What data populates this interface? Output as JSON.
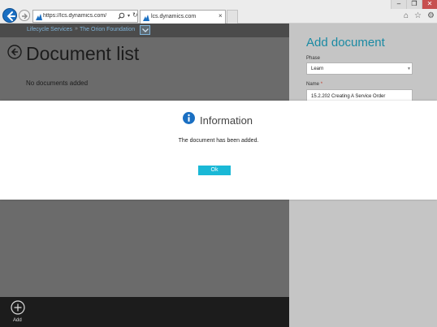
{
  "browser": {
    "address_text": "https://lcs.dynamics.com/Docum",
    "tab_title": "lcs.dynamics.com"
  },
  "breadcrumb": {
    "root": "Lifecycle Services",
    "separator": "»",
    "project": "The Orion Foundation"
  },
  "main": {
    "title": "Document list",
    "empty_message": "No documents added"
  },
  "bottom_bar": {
    "add_label": "Add"
  },
  "panel": {
    "title": "Add document",
    "phase_label": "Phase",
    "phase_value": "Learn",
    "name_label": "Name",
    "name_required": "*",
    "name_value": "15.2.202 Creating A Service Order"
  },
  "dialog": {
    "title": "Information",
    "message": "The document has been added.",
    "ok_label": "Ok"
  },
  "colors": {
    "accent": "#1ab8d6",
    "panel_title": "#1a8aa3",
    "info_icon": "#1a6fc2"
  }
}
